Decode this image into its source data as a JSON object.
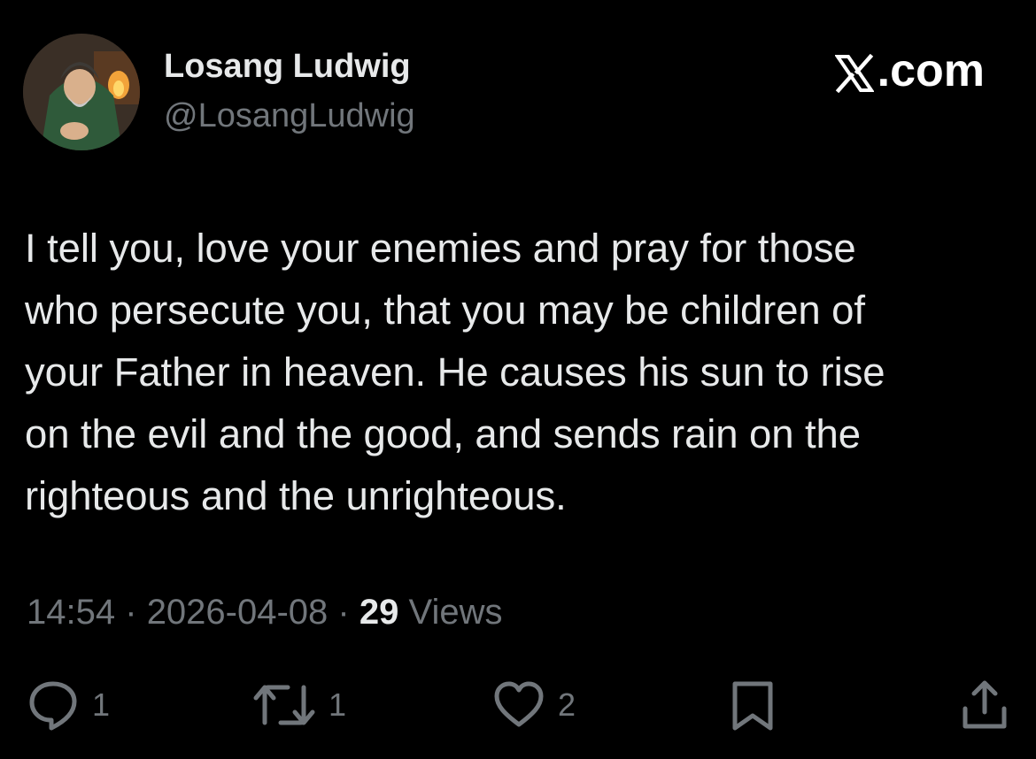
{
  "author": {
    "display_name": "Losang Ludwig",
    "handle": "@LosangLudwig"
  },
  "brand": {
    "label": ".com",
    "logo_icon": "x-logo-icon"
  },
  "tweet": {
    "text": "I tell you, love your enemies and pray for those\nwho persecute you, that you may be children of\nyour Father in heaven. He causes his sun to rise\non the evil and the good, and sends rain on the\nrighteous and the unrighteous."
  },
  "meta": {
    "time": "14:54",
    "separator": "·",
    "date": "2026-04-08",
    "views_count": "29",
    "views_label": "Views"
  },
  "actions": {
    "reply_count": "1",
    "retweet_count": "1",
    "like_count": "2"
  },
  "colors": {
    "background": "#000000",
    "primary_text": "#e7e9ea",
    "secondary_text": "#71767b"
  }
}
